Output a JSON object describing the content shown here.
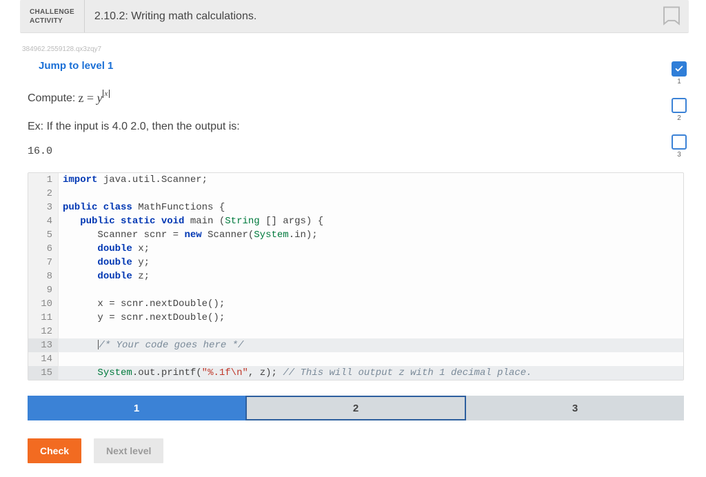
{
  "header": {
    "label_line1": "CHALLENGE",
    "label_line2": "ACTIVITY",
    "title": "2.10.2: Writing math calculations."
  },
  "meta_id": "384962.2559128.qx3zqy7",
  "jump_link": "Jump to level 1",
  "prompt": {
    "compute_prefix": "Compute: ",
    "var_z": "z",
    "eq": " = ",
    "var_y": "y",
    "exp_var": "x",
    "example": "Ex: If the input is 4.0 2.0, then the output is:",
    "output": "16.0"
  },
  "levels": [
    {
      "num": "1",
      "done": true
    },
    {
      "num": "2",
      "done": false
    },
    {
      "num": "3",
      "done": false
    }
  ],
  "code_lines": [
    {
      "n": "1",
      "hl": false,
      "html": "<span class='kw'>import</span> java.util.Scanner;"
    },
    {
      "n": "2",
      "hl": false,
      "html": ""
    },
    {
      "n": "3",
      "hl": false,
      "html": "<span class='kw'>public class</span> MathFunctions {"
    },
    {
      "n": "4",
      "hl": false,
      "html": "   <span class='kw'>public static</span> <span class='type'>void</span> main (<span class='cls'>String</span> [] args) {"
    },
    {
      "n": "5",
      "hl": false,
      "html": "      Scanner scnr = <span class='kw'>new</span> Scanner(<span class='cls'>System</span>.in);"
    },
    {
      "n": "6",
      "hl": false,
      "html": "      <span class='type'>double</span> x;"
    },
    {
      "n": "7",
      "hl": false,
      "html": "      <span class='type'>double</span> y;"
    },
    {
      "n": "8",
      "hl": false,
      "html": "      <span class='type'>double</span> z;"
    },
    {
      "n": "9",
      "hl": false,
      "html": ""
    },
    {
      "n": "10",
      "hl": false,
      "html": "      x = scnr.nextDouble();"
    },
    {
      "n": "11",
      "hl": false,
      "html": "      y = scnr.nextDouble();"
    },
    {
      "n": "12",
      "hl": false,
      "html": ""
    },
    {
      "n": "13",
      "hl": true,
      "html": "      <span class='caret'></span><span class='cmt'>/* Your code goes here */</span>"
    },
    {
      "n": "14",
      "hl": false,
      "html": ""
    },
    {
      "n": "15",
      "hl": true,
      "html": "      <span class='cls'>System</span>.out.printf(<span class='str'>\"%.1f\\n\"</span>, z); <span class='cmt'>// This will output z with 1 decimal place.</span>"
    }
  ],
  "tabs": [
    "1",
    "2",
    "3"
  ],
  "buttons": {
    "check": "Check",
    "next": "Next level"
  }
}
